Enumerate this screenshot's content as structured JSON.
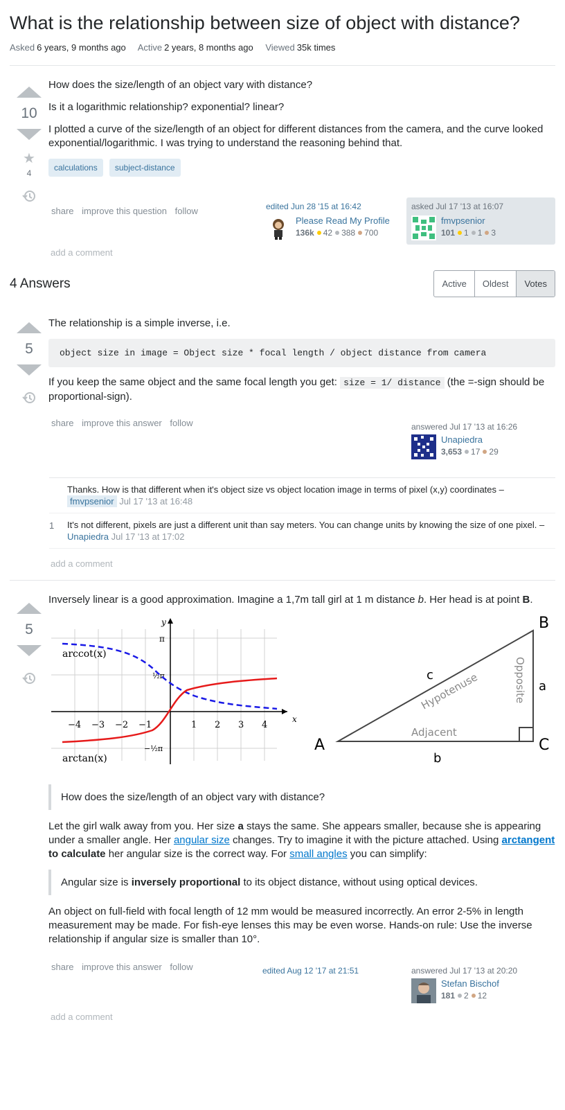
{
  "question": {
    "title": "What is the relationship between size of object with distance?",
    "asked_label": "Asked",
    "asked_value": "6 years, 9 months ago",
    "active_label": "Active",
    "active_value": "2 years, 8 months ago",
    "viewed_label": "Viewed",
    "viewed_value": "35k times",
    "votes": "10",
    "favorites": "4",
    "body": [
      "How does the size/length of an object vary with distance?",
      "Is it a logarithmic relationship? exponential? linear?",
      "I plotted a curve of the size/length of an object for different distances from the camera, and the curve looked exponential/logarithmic. I was trying to understand the reasoning behind that."
    ],
    "tags": [
      "calculations",
      "subject-distance"
    ],
    "menu": {
      "share": "share",
      "improve": "improve this question",
      "follow": "follow"
    },
    "edited": {
      "when": "edited Jun 28 '15 at 16:42",
      "user": "Please Read My Profile",
      "rep": "136k",
      "gold": "42",
      "silver": "388",
      "bronze": "700"
    },
    "asked": {
      "when": "asked Jul 17 '13 at 16:07",
      "user": "fmvpsenior",
      "rep": "101",
      "gold": "1",
      "silver": "1",
      "bronze": "3"
    },
    "add_comment": "add a comment"
  },
  "answers_header": {
    "count_label": "4 Answers",
    "tabs": [
      "Active",
      "Oldest",
      "Votes"
    ]
  },
  "answer1": {
    "votes": "5",
    "intro": "The relationship is a simple inverse, i.e.",
    "code": "object size in image = Object size * focal length / object distance from camera",
    "text_before": "If you keep the same object and the same focal length you get:",
    "inline_code": "size = 1/ distance",
    "text_after": "(the =-sign should be proportional-sign).",
    "menu": {
      "share": "share",
      "improve": "improve this answer",
      "follow": "follow"
    },
    "answered": {
      "when": "answered Jul 17 '13 at 16:26",
      "user": "Unapiedra",
      "rep": "3,653",
      "silver": "17",
      "bronze": "29"
    },
    "comments": [
      {
        "score": "",
        "text": "Thanks. How is that different when it's object size vs object location image in terms of pixel (x,y) coordinates –",
        "user": "fmvpsenior",
        "date": "Jul 17 '13 at 16:48"
      },
      {
        "score": "1",
        "text": "It's not different, pixels are just a different unit than say meters. You can change units by knowing the size of one pixel. –",
        "user": "Unapiedra",
        "date": "Jul 17 '13 at 17:02"
      }
    ],
    "add_comment": "add a comment"
  },
  "answer2": {
    "votes": "5",
    "p1_a": "Inversely linear is a good approximation. Imagine a 1,7m tall girl at 1 m distance",
    "p1_b": "b",
    "p1_c": ". Her head is at point",
    "p1_d": "B",
    "p1_e": ".",
    "quote1": "How does the size/length of an object vary with distance?",
    "p2_a": "Let the girl walk away from you. Her size",
    "p2_b": "a",
    "p2_c": "stays the same. She appears smaller, because she is appearing under a smaller angle. Her",
    "p2_link1": "angular size",
    "p2_d": "changes. Try to imagine it with the picture attached. Using",
    "p2_link2": "arctangent",
    "p2_e": "to calculate",
    "p2_f": "her angular size is the correct way. For",
    "p2_link3": "small angles",
    "p2_g": "you can simplify:",
    "quote2_a": "Angular size is",
    "quote2_b": "inversely proportional",
    "quote2_c": "to its object distance, without using optical devices.",
    "p3": "An object on full-field with focal length of 12 mm would be measured incorrectly. An error 2-5% in length measurement may be made. For fish-eye lenses this may be even worse. Hands-on rule: Use the inverse relationship if angular size is smaller than 10°.",
    "menu": {
      "share": "share",
      "improve": "improve this answer",
      "follow": "follow"
    },
    "edited_when": "edited Aug 12 '17 at 21:51",
    "answered": {
      "when": "answered Jul 17 '13 at 20:20",
      "user": "Stefan Bischof",
      "rep": "181",
      "silver": "2",
      "bronze": "12"
    },
    "add_comment": "add a comment",
    "graph": {
      "x_label": "x",
      "y_label": "y",
      "x_ticks": [
        "−4",
        "−3",
        "−2",
        "−1",
        "1",
        "2",
        "3",
        "4"
      ],
      "y_pi": "π",
      "y_half_pi": "½π",
      "y_neg_half_pi": "−½π",
      "curve1_label": "arccot(x)",
      "curve2_label": "arctan(x)",
      "colors": {
        "arccot": "#1a1ae6",
        "arctan": "#e61a1a"
      }
    },
    "triangle": {
      "A": "A",
      "B": "B",
      "C": "C",
      "a": "a",
      "b": "b",
      "c": "c",
      "hyp": "Hypotenuse",
      "adj": "Adjacent",
      "opp": "Opposite"
    }
  }
}
